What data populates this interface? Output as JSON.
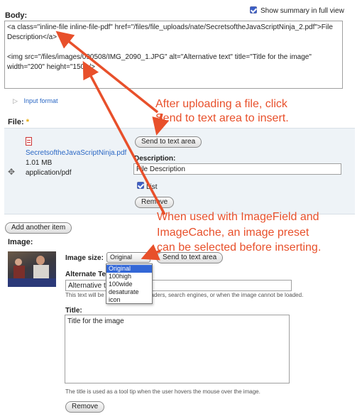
{
  "summary": {
    "label": "Show summary in full view",
    "checked": true
  },
  "body": {
    "label": "Body:",
    "content": "<a class=\"inline-file inline-file-pdf\" href=\"/files/file_uploads/nate/SecretsoftheJavaScriptNinja_2.pdf\">File Description</a>\n\n<img src=\"/files/images/090508/IMG_2090_1.JPG\" alt=\"Alternative text\" title=\"Title for the image\"\nwidth=\"200\" height=\"150\" />"
  },
  "input_format": {
    "label": "Input format"
  },
  "file": {
    "label": "File:",
    "required_mark": "*",
    "filename": "SecretsoftheJavaScriptNinja.pdf",
    "size": "1.01 MB",
    "mime": "application/pdf",
    "send_button": "Send to text area",
    "description_label": "Description:",
    "description_value": "File Description",
    "list_label": "List",
    "list_checked": true,
    "remove_button": "Remove"
  },
  "add_another_button": "Add another item",
  "image": {
    "label": "Image:",
    "size_label": "Image size:",
    "size_selected": "Original",
    "size_options": [
      "Original",
      "100high",
      "100wide",
      "desaturate",
      "icon"
    ],
    "send_button": "Send to text area",
    "alt_label": "Alternate Text:",
    "alt_value": "Alternative text",
    "alt_desc": "This text will be used by screen readers, search engines, or when the image cannot be loaded.",
    "title_label": "Title:",
    "title_value": "Title for the image",
    "title_desc": "The title is used as a tool tip when the user hovers the mouse over the image.",
    "remove_button": "Remove"
  },
  "annotations": {
    "first_line1": "After uploading a file, click",
    "first_line2": "Send to text area to insert.",
    "second_line1": "When used with ImageField and",
    "second_line2": "ImageCache, an image preset",
    "second_line3": "can be selected before inserting."
  },
  "colors": {
    "annotation": "#e8502b",
    "link": "#2a67c4",
    "file_panel": "#eef3f7"
  }
}
